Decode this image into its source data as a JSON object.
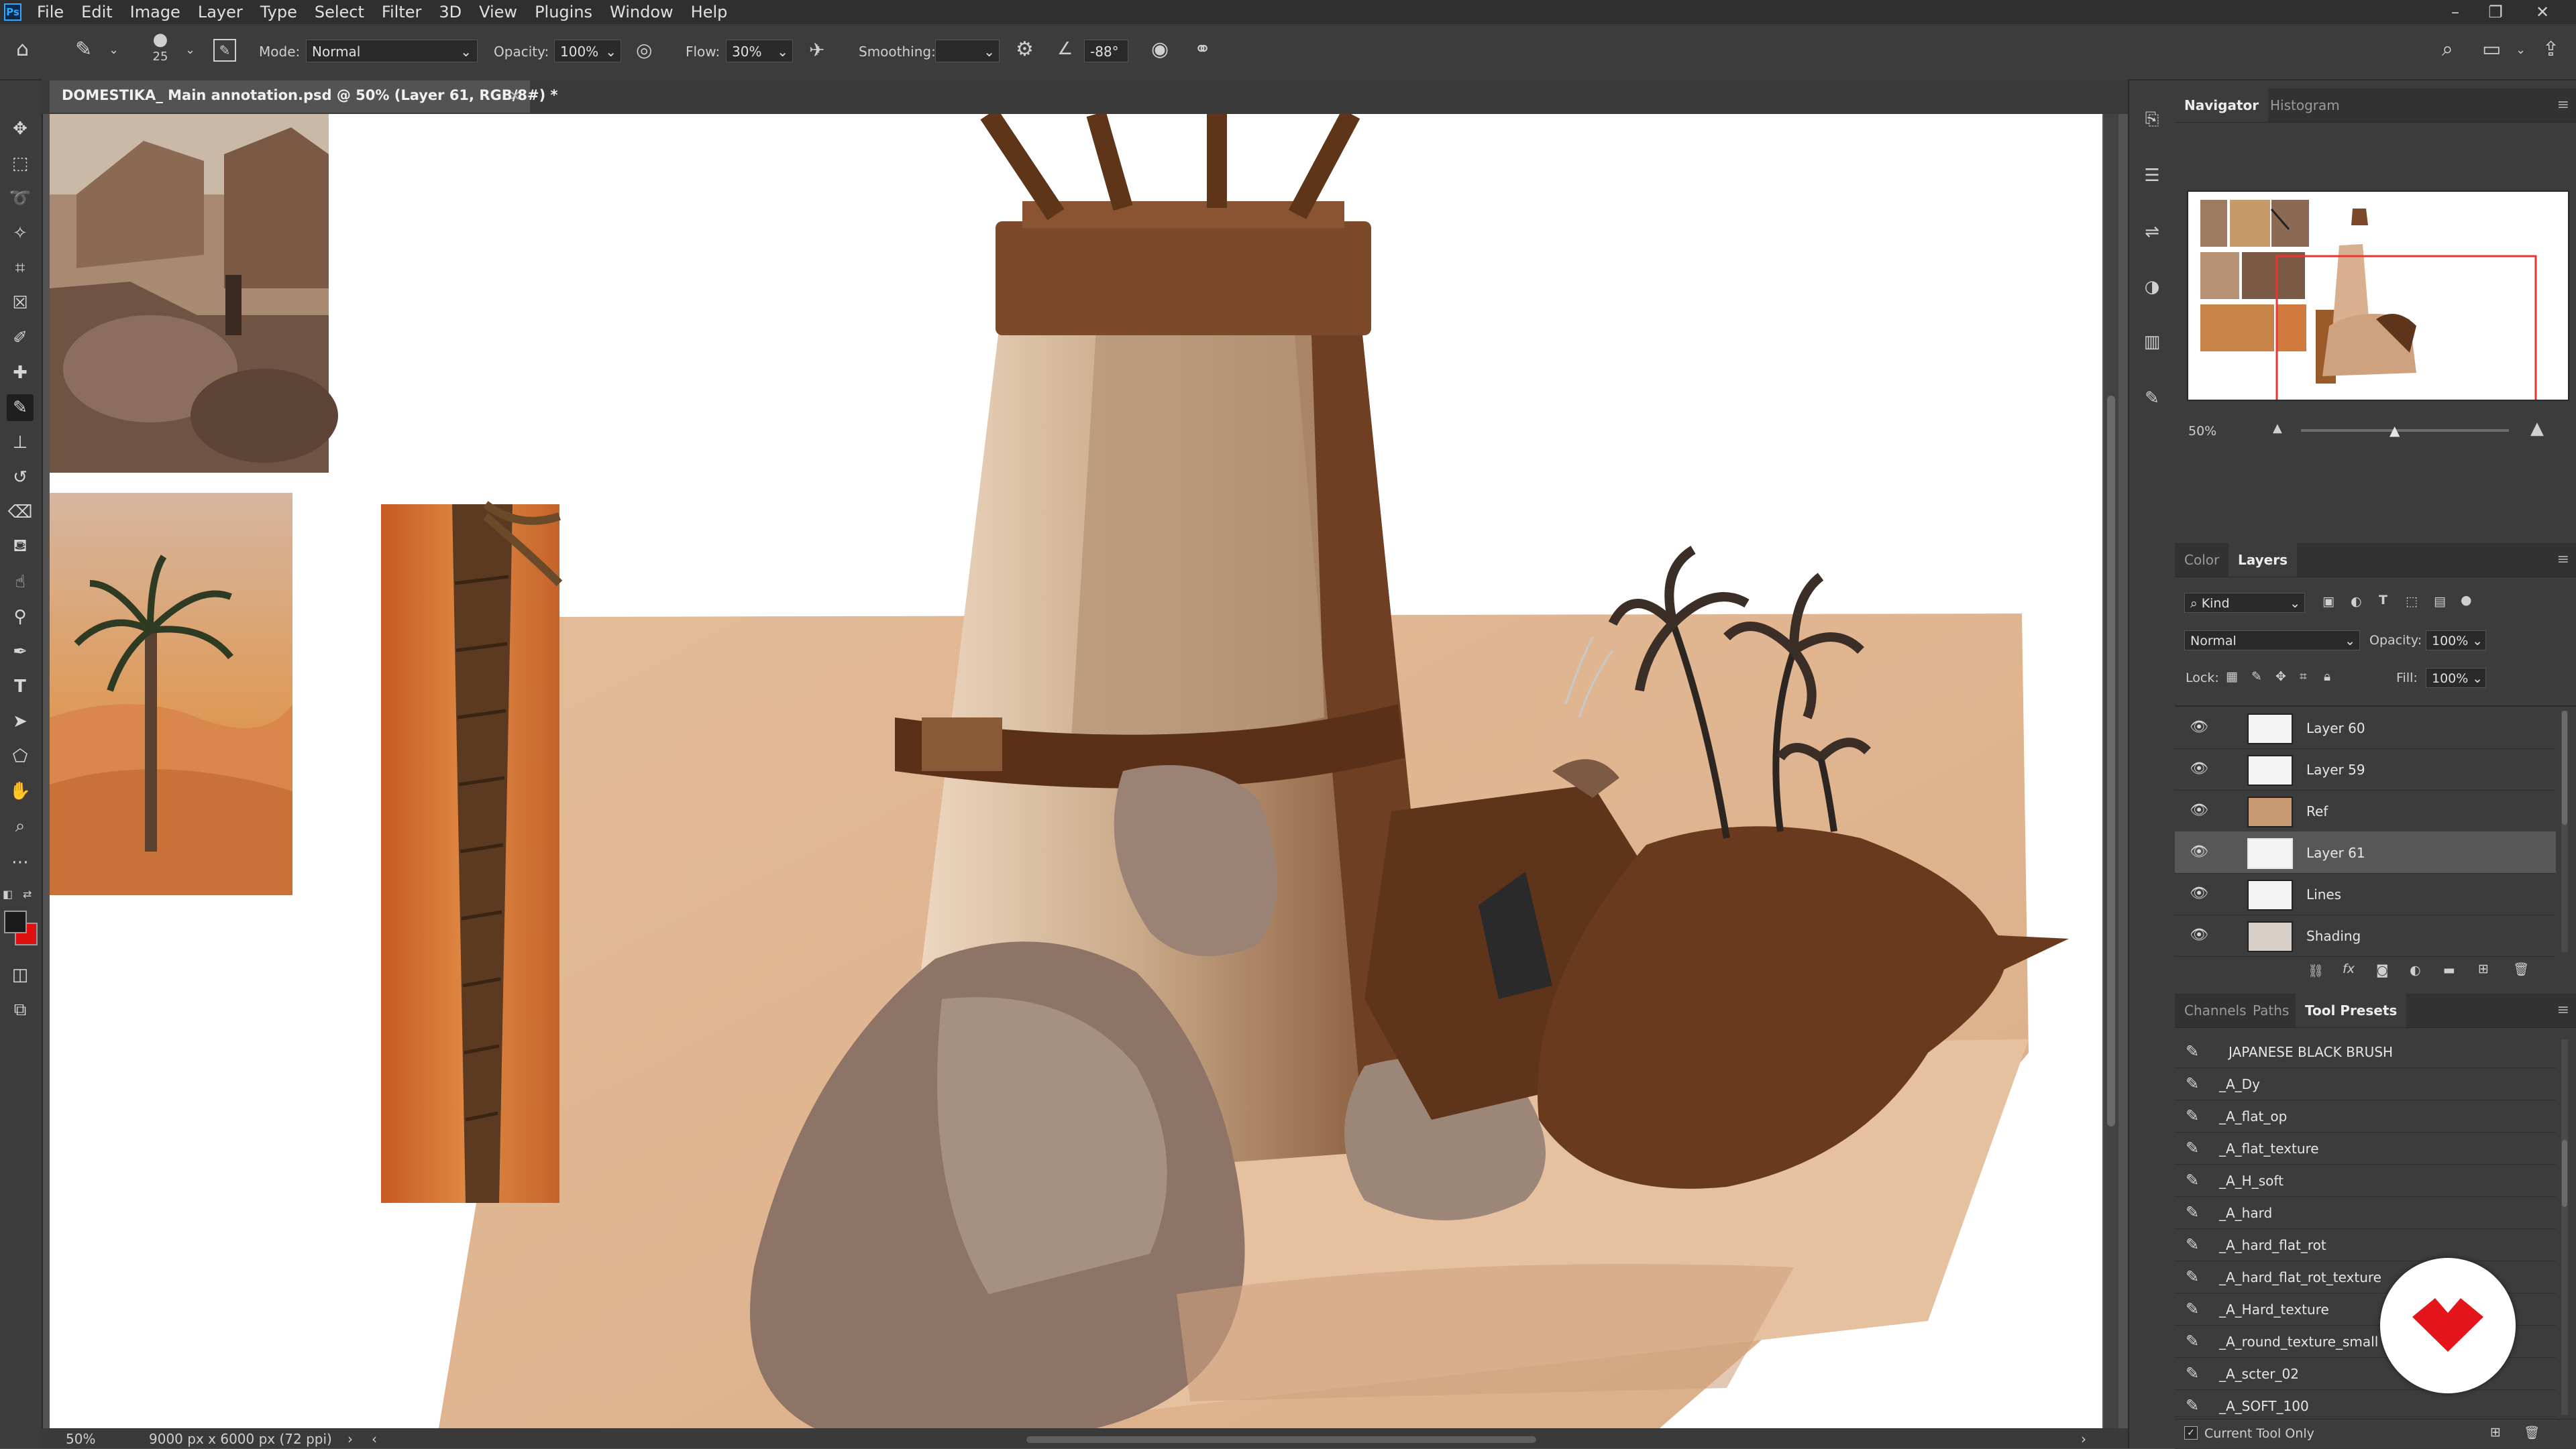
{
  "app": {
    "logo": "Ps"
  },
  "menu": [
    "File",
    "Edit",
    "Image",
    "Layer",
    "Type",
    "Select",
    "Filter",
    "3D",
    "View",
    "Plugins",
    "Window",
    "Help"
  ],
  "window_controls": {
    "minimize": "–",
    "restore": "❐",
    "close": "✕"
  },
  "options_bar": {
    "brush_size": "25",
    "mode_label": "Mode:",
    "mode_value": "Normal",
    "opacity_label": "Opacity:",
    "opacity_value": "100%",
    "flow_label": "Flow:",
    "flow_value": "30%",
    "smoothing_label": "Smoothing:",
    "smoothing_value": "",
    "angle_value": "-88°"
  },
  "document_tab": {
    "title": "DOMESTIKA_ Main annotation.psd @ 50% (Layer 61, RGB/8#) *",
    "close": "×"
  },
  "status_bar": {
    "zoom": "50%",
    "doc_size": "9000 px x 6000 px (72 ppi)",
    "arrow": "›",
    "scroll_left": "‹",
    "scroll_right": "›"
  },
  "navigator": {
    "tabs": [
      "Navigator",
      "Histogram"
    ],
    "active_tab": "Navigator",
    "zoom": "50%"
  },
  "layers_panel": {
    "tabs": [
      "Color",
      "Layers"
    ],
    "active_tab": "Layers",
    "filter_label": "Kind",
    "blend_mode": "Normal",
    "opacity_label": "Opacity:",
    "opacity_value": "100%",
    "lock_label": "Lock:",
    "fill_label": "Fill:",
    "fill_value": "100%",
    "layers": [
      {
        "name": "Layer 60",
        "visible": true,
        "selected": false
      },
      {
        "name": "Layer 59",
        "visible": true,
        "selected": false
      },
      {
        "name": "Ref",
        "visible": true,
        "selected": false
      },
      {
        "name": "Layer 61",
        "visible": true,
        "selected": true
      },
      {
        "name": "Lines",
        "visible": true,
        "selected": false
      },
      {
        "name": "Shading",
        "visible": true,
        "selected": false
      }
    ],
    "footer_icons": [
      "link-icon",
      "fx-icon",
      "mask-icon",
      "adjustment-icon",
      "folder-icon",
      "new-layer-icon",
      "trash-icon"
    ]
  },
  "presets_panel": {
    "tabs": [
      "Channels",
      "Paths",
      "Tool Presets"
    ],
    "active_tab": "Tool Presets",
    "presets": [
      "JAPANESE BLACK BRUSH",
      "_A_Dy",
      "_A_flat_op",
      "_A_flat_texture",
      "_A_H_soft",
      "_A_hard",
      "_A_hard_flat_rot",
      "_A_hard_flat_rot_texture",
      "_A_Hard_texture",
      "_A_round_texture_small",
      "_A_scter_02",
      "_A_SOFT_100"
    ],
    "current_tool_only_label": "Current Tool Only",
    "current_tool_only": true
  },
  "colors": {
    "menubar": "#2f2f2f",
    "panel": "#3c3c3c",
    "workspace": "#535353",
    "foreground": "#1a1a1a",
    "background_swatch": "#e01010",
    "brand_red": "#e3151a"
  }
}
